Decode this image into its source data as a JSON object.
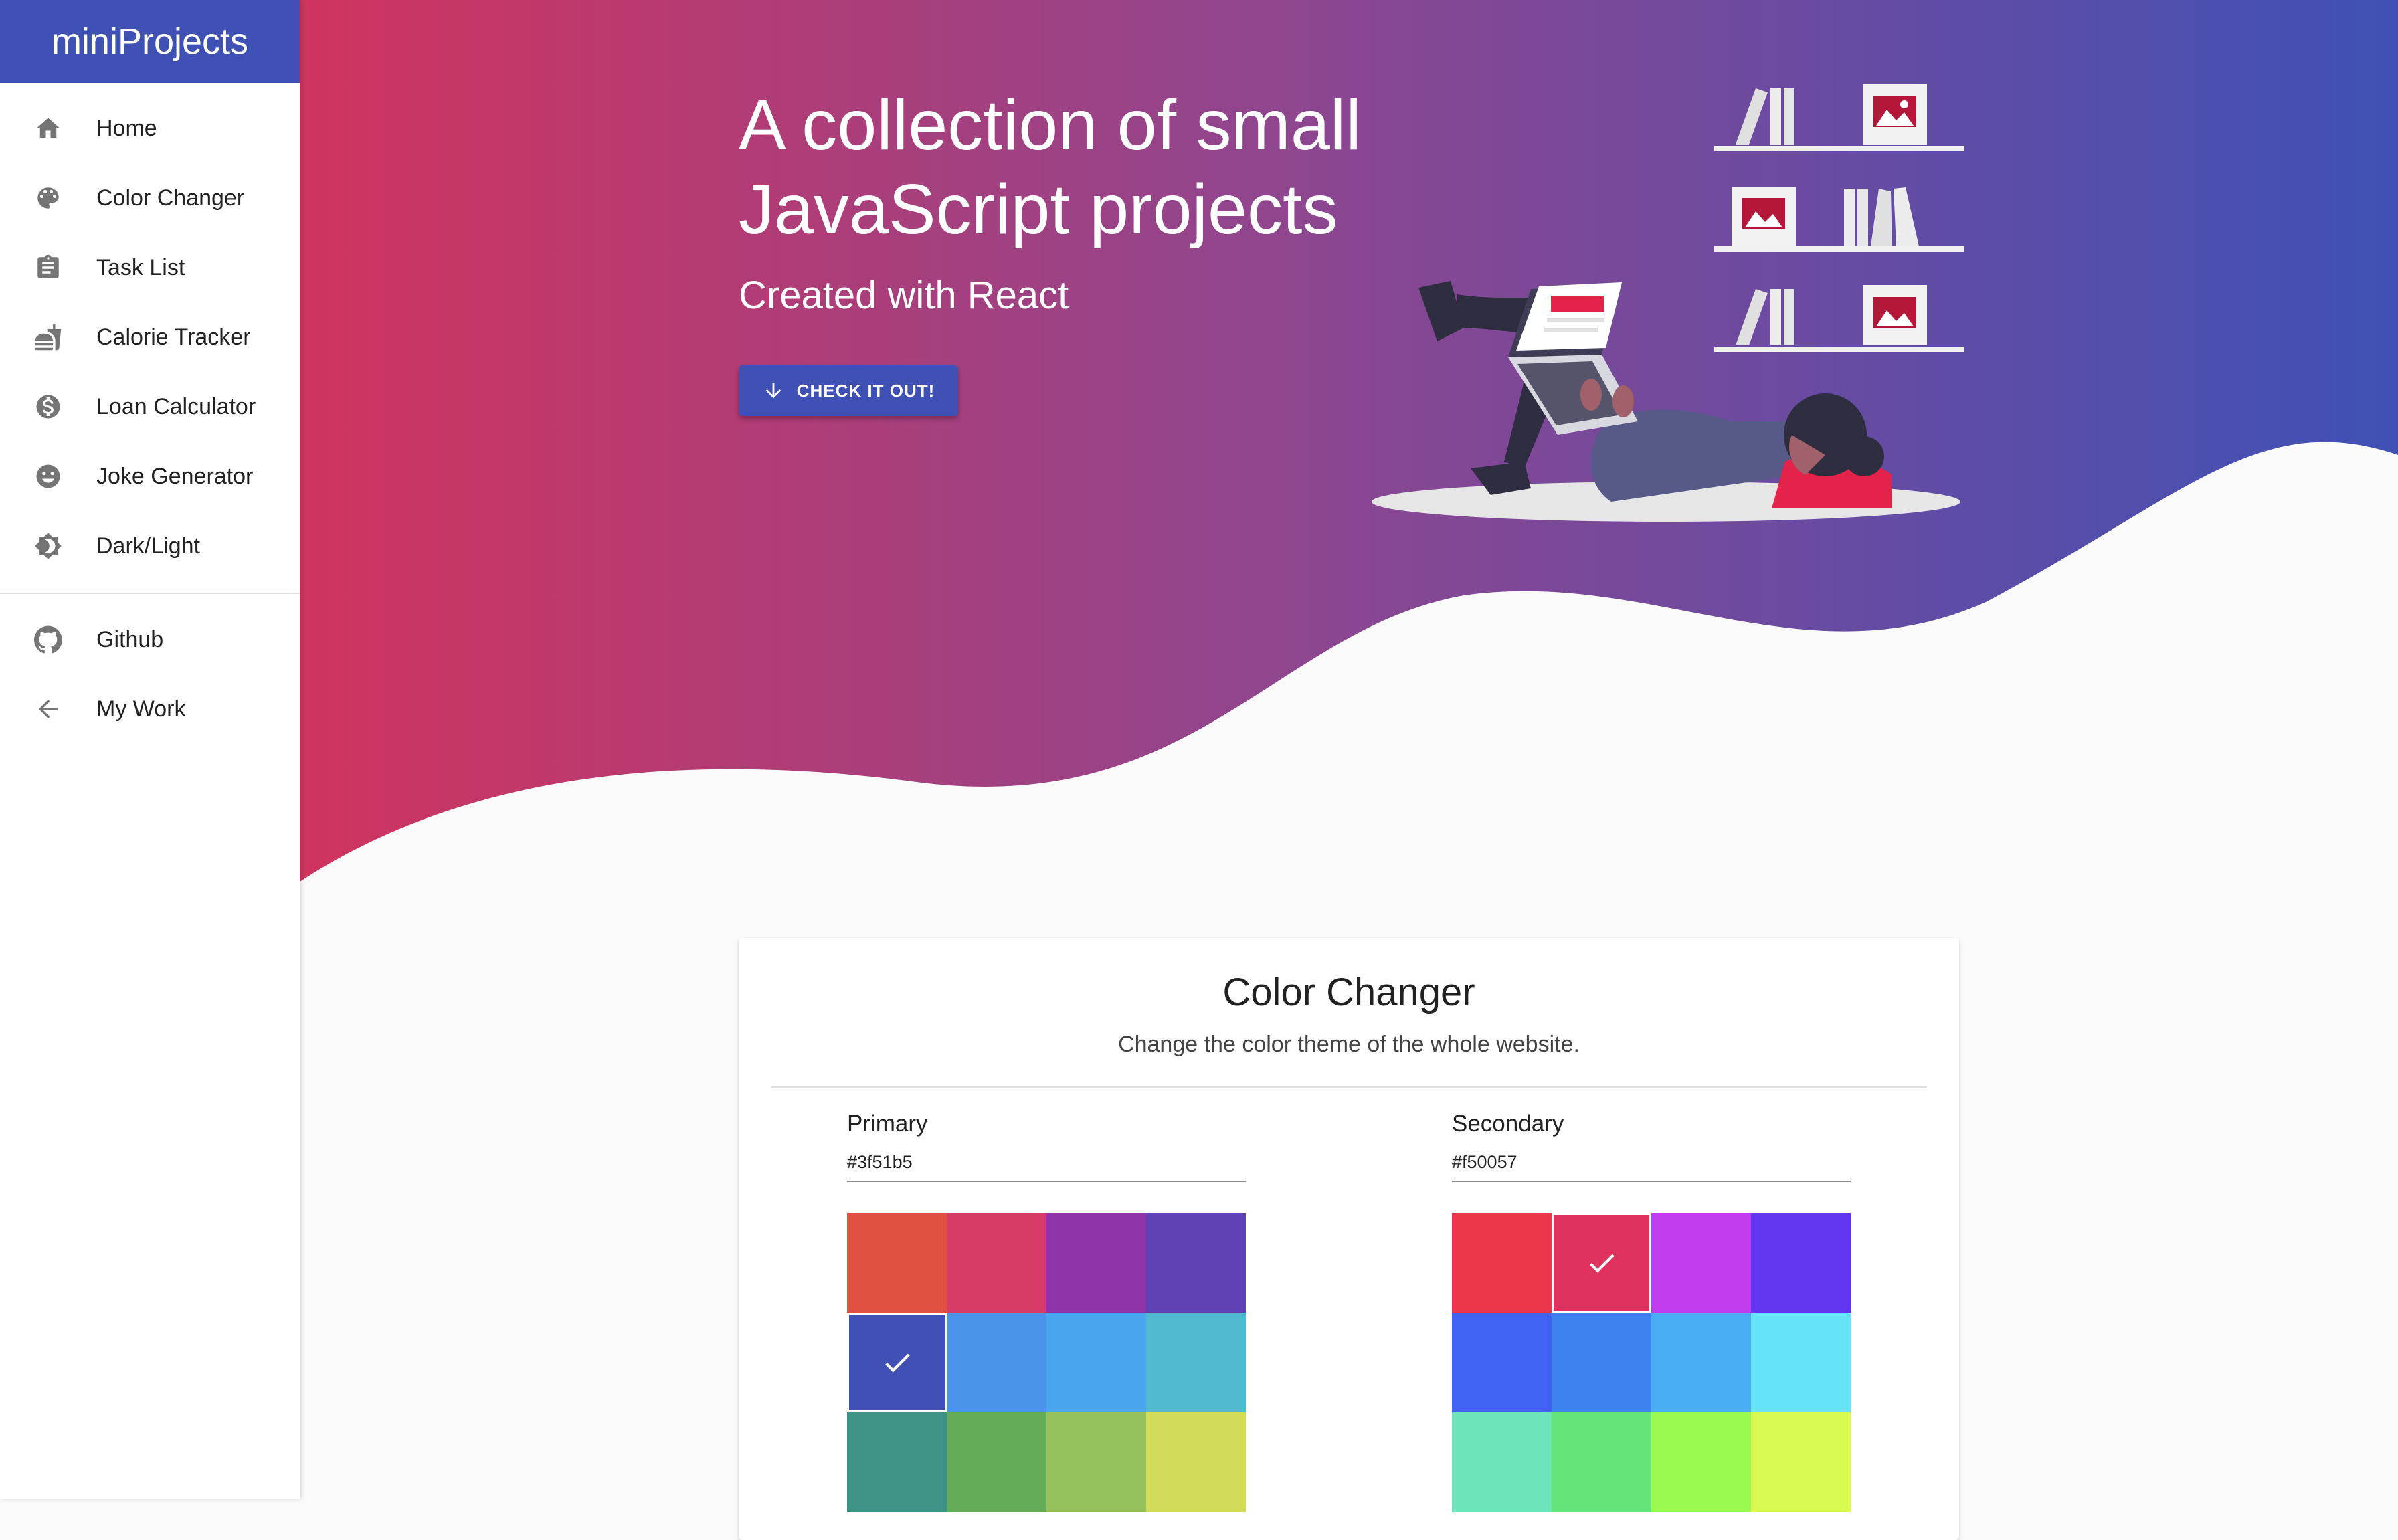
{
  "sidebar": {
    "brand": "miniProjects",
    "items": [
      {
        "label": "Home",
        "icon": "home-icon"
      },
      {
        "label": "Color Changer",
        "icon": "palette-icon"
      },
      {
        "label": "Task List",
        "icon": "clipboard-icon"
      },
      {
        "label": "Calorie Tracker",
        "icon": "fastfood-icon"
      },
      {
        "label": "Loan Calculator",
        "icon": "dollar-icon"
      },
      {
        "label": "Joke Generator",
        "icon": "smiley-icon"
      },
      {
        "label": "Dark/Light",
        "icon": "brightness-icon"
      }
    ],
    "links": [
      {
        "label": "Github",
        "icon": "github-icon"
      },
      {
        "label": "My Work",
        "icon": "arrow-back-icon"
      }
    ]
  },
  "hero": {
    "title": "A collection of small JavaScript projects",
    "subtitle": "Created with React",
    "cta_label": "CHECK IT OUT!"
  },
  "colors": {
    "primary": "#3f51b5",
    "secondary": "#f50057",
    "gradient_start": "#d0345f",
    "gradient_end": "#3f51b5"
  },
  "card": {
    "title": "Color Changer",
    "description": "Change the color theme of the whole website.",
    "primary": {
      "label": "Primary",
      "value": "#3f51b5",
      "selected_index": 4,
      "swatches": [
        "#e05141",
        "#d53b64",
        "#8f35a8",
        "#5f42b3",
        "#4050b5",
        "#4a95e9",
        "#4aa5ef",
        "#52b9d1",
        "#3f9286",
        "#64ac58",
        "#95c25c",
        "#d3dc5a"
      ]
    },
    "secondary": {
      "label": "Secondary",
      "value": "#f50057",
      "selected_index": 1,
      "swatches": [
        "#eb364c",
        "#e0325f",
        "#c03cec",
        "#6336f2",
        "#4163f3",
        "#3e82f0",
        "#4aaef5",
        "#67e3f8",
        "#6be5b9",
        "#64e47a",
        "#9bfa4f",
        "#d8fa50"
      ]
    }
  }
}
